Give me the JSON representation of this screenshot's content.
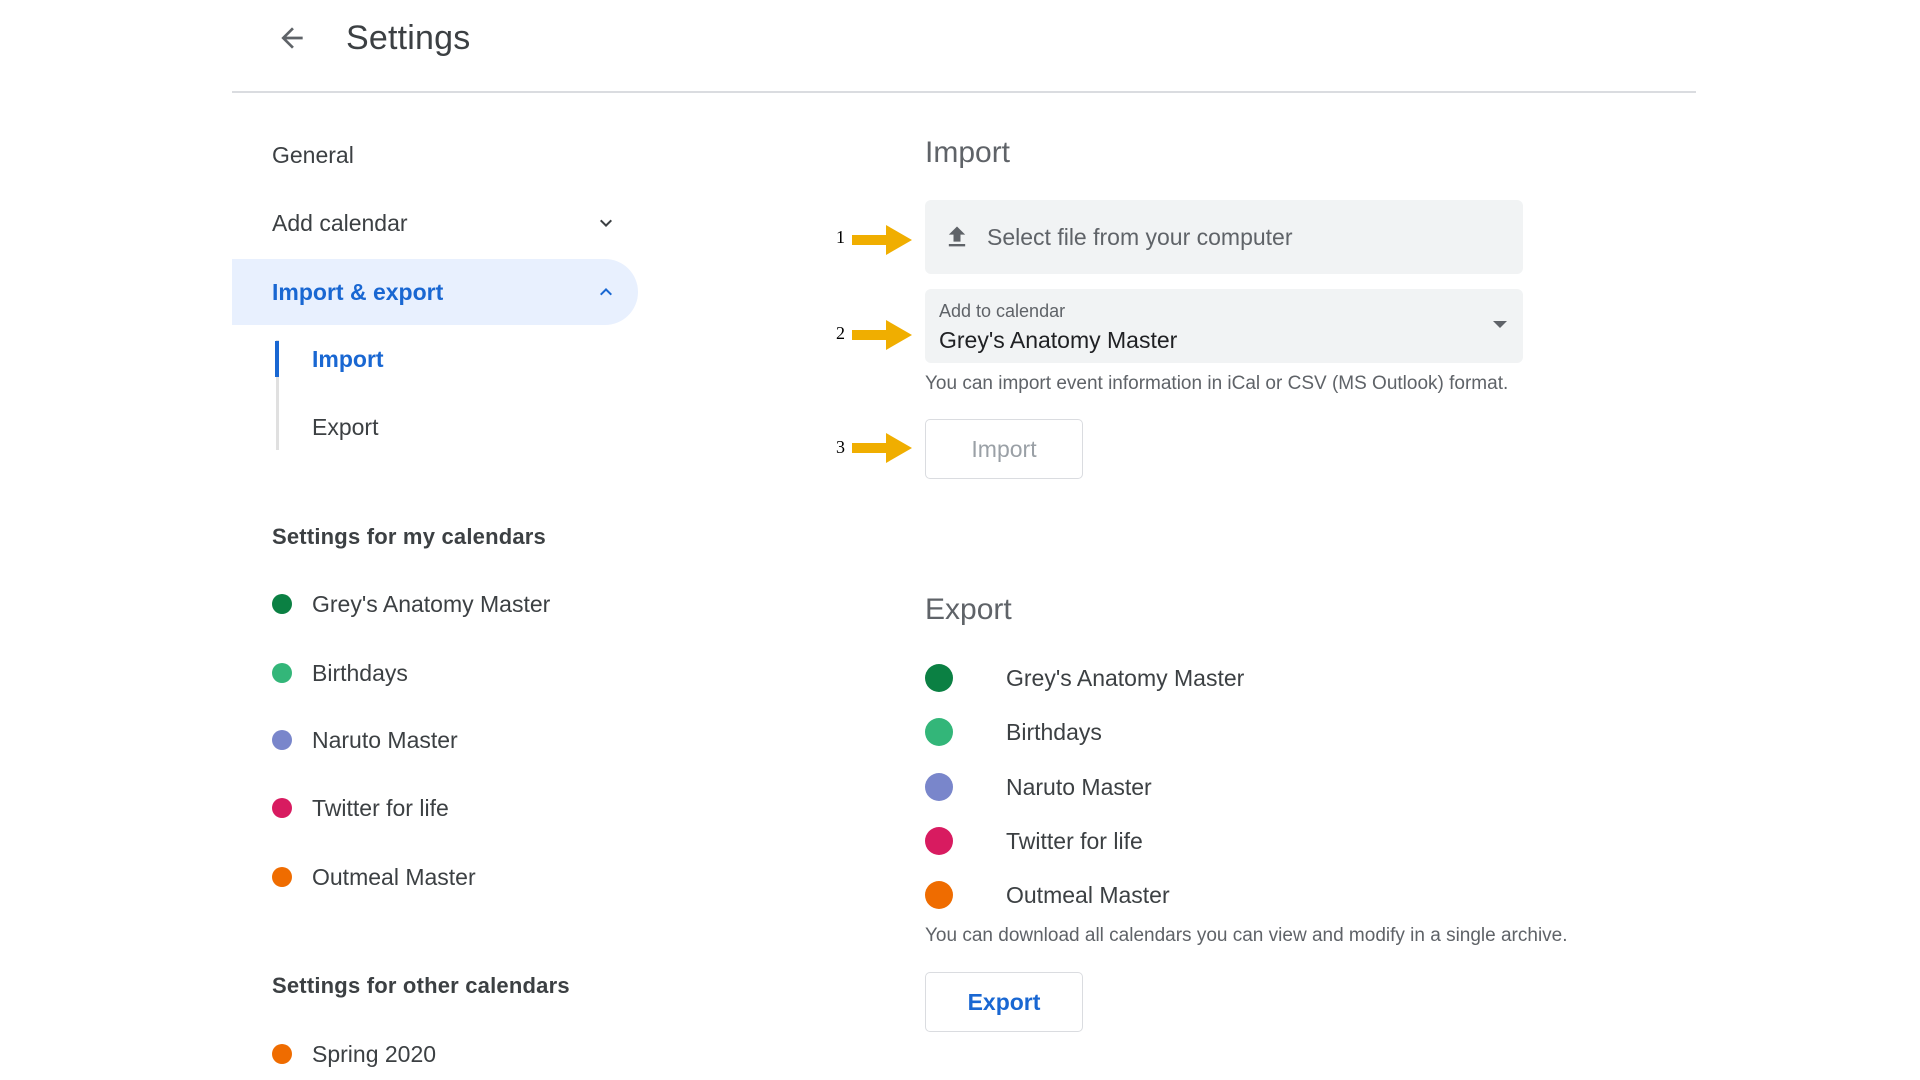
{
  "header": {
    "title": "Settings",
    "back_icon": "arrow-left-icon"
  },
  "sidebar": {
    "items": [
      {
        "label": "General"
      },
      {
        "label": "Add calendar",
        "icon": "chevron-down-icon"
      },
      {
        "label": "Import & export",
        "icon": "chevron-up-icon",
        "active": true
      }
    ],
    "sub_items": [
      {
        "label": "Import",
        "active": true
      },
      {
        "label": "Export"
      }
    ],
    "my_calendars_heading": "Settings for my calendars",
    "my_calendars": [
      {
        "name": "Grey's Anatomy Master",
        "color": "#0B8043"
      },
      {
        "name": "Birthdays",
        "color": "#33B679"
      },
      {
        "name": "Naruto Master",
        "color": "#7986CB"
      },
      {
        "name": "Twitter for life",
        "color": "#D81B60"
      },
      {
        "name": "Outmeal Master",
        "color": "#EF6C00"
      }
    ],
    "other_calendars_heading": "Settings for other calendars",
    "other_calendars": [
      {
        "name": "Spring 2020",
        "color": "#EF6C00"
      }
    ]
  },
  "import": {
    "title": "Import",
    "select_file_label": "Select file from your computer",
    "select_file_icon": "upload-icon",
    "add_to_calendar_label": "Add to calendar",
    "add_to_calendar_value": "Grey's Anatomy Master",
    "help_text": "You can import event information in iCal or CSV (MS Outlook) format.",
    "button_label": "Import"
  },
  "export": {
    "title": "Export",
    "calendars": [
      {
        "name": "Grey's Anatomy Master",
        "color": "#0B8043"
      },
      {
        "name": "Birthdays",
        "color": "#33B679"
      },
      {
        "name": "Naruto Master",
        "color": "#7986CB"
      },
      {
        "name": "Twitter for life",
        "color": "#D81B60"
      },
      {
        "name": "Outmeal Master",
        "color": "#EF6C00"
      }
    ],
    "help_text": "You can download all calendars you can view and modify in a single archive.",
    "button_label": "Export"
  },
  "annotations": [
    {
      "number": "1",
      "color": "#F0AE00"
    },
    {
      "number": "2",
      "color": "#F0AE00"
    },
    {
      "number": "3",
      "color": "#F0AE00"
    }
  ],
  "colors": {
    "accent": "#1967D2",
    "active_bg": "#E8F0FE",
    "field_bg": "#F1F3F4",
    "annotation_arrow": "#F0AE00"
  }
}
